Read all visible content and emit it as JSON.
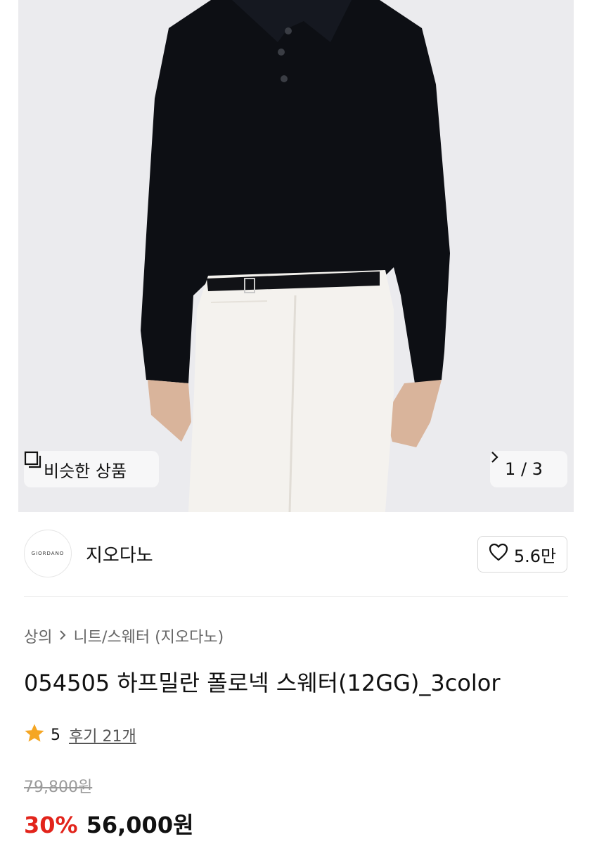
{
  "gallery": {
    "similar_label": "비슷한 상품",
    "pager": "1 / 3"
  },
  "brand": {
    "logo_text": "GIORDANO",
    "name": "지오다노",
    "likes": "5.6만"
  },
  "breadcrumb": {
    "category": "상의",
    "subcategory": "니트/스웨터 (지오다노)"
  },
  "product": {
    "title": "054505 하프밀란 폴로넥 스웨터(12GG)_3color",
    "rating": "5",
    "reviews": "후기 21개",
    "original_price": "79,800원",
    "discount": "30%",
    "final_price": "56,000원"
  },
  "colors": {
    "discount_red": "#e2241b",
    "star": "#f5a623"
  }
}
